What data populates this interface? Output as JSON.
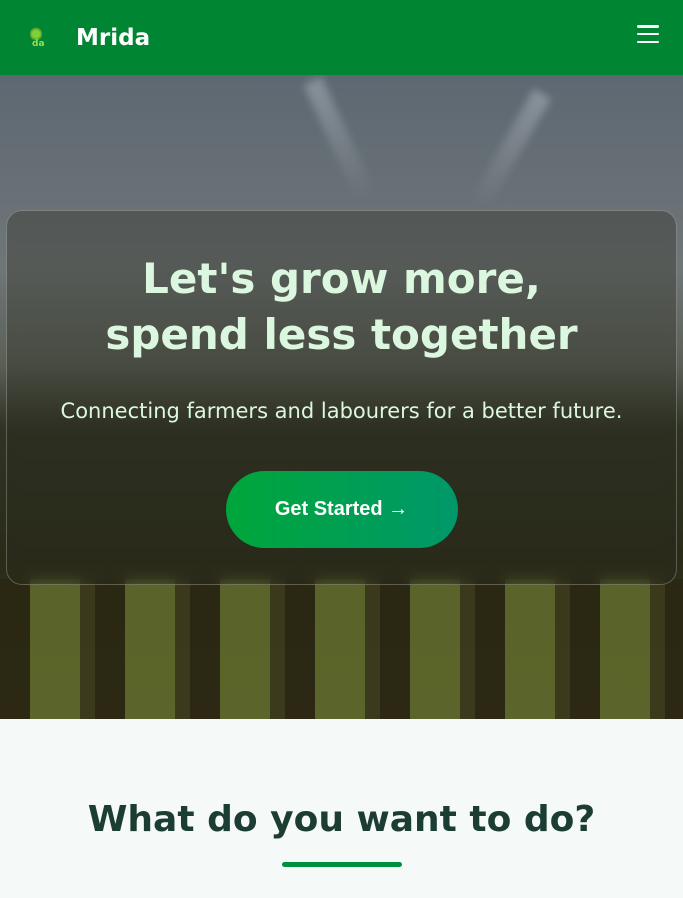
{
  "nav": {
    "brand": "Mrida",
    "logo_text": "da",
    "menu_icon": "hamburger-menu-icon"
  },
  "hero": {
    "title_line1": "Let's grow more,",
    "title_line2": "spend less together",
    "subtitle": "Connecting farmers and labourers for a better future.",
    "cta": "Get Started →"
  },
  "section": {
    "title": "What do you want to do?"
  },
  "colors": {
    "nav": "#008532",
    "accent": "#00a63a",
    "heading": "#1c3d33"
  }
}
